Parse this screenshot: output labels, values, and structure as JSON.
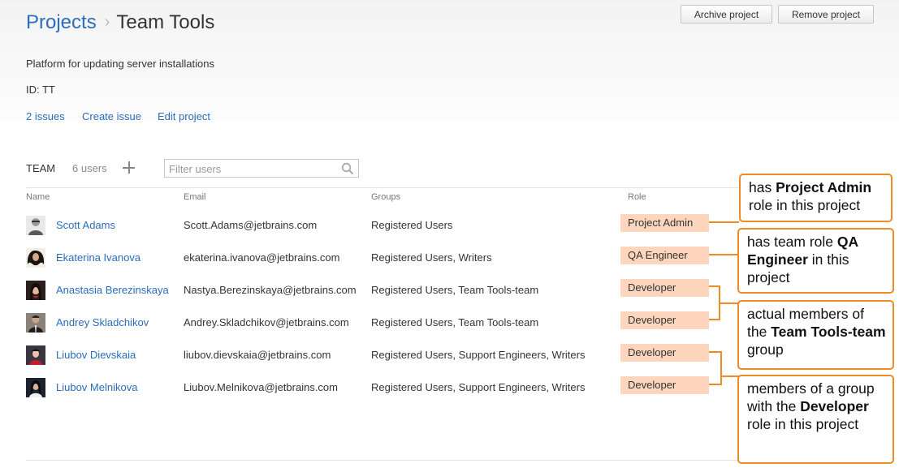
{
  "breadcrumb": {
    "root": "Projects",
    "separator": "›",
    "current": "Team Tools"
  },
  "header_buttons": {
    "archive": "Archive project",
    "remove": "Remove project"
  },
  "project": {
    "description": "Platform for updating server installations",
    "id": "ID: TT",
    "links": [
      "2 issues",
      "Create issue",
      "Edit project"
    ]
  },
  "team": {
    "label": "TEAM",
    "count": "6 users",
    "filter_placeholder": "Filter users"
  },
  "columns": {
    "name": "Name",
    "email": "Email",
    "groups": "Groups",
    "role": "Role"
  },
  "members": [
    {
      "name": "Scott Adams",
      "email": "Scott.Adams@jetbrains.com",
      "groups": "Registered Users",
      "role": "Project Admin",
      "avatar": "gray-portrait"
    },
    {
      "name": "Ekaterina Ivanova",
      "email": "ekaterina.ivanova@jetbrains.com",
      "groups": "Registered Users, Writers",
      "role": "QA Engineer",
      "avatar": "dark-hair-portrait"
    },
    {
      "name": "Anastasia Berezinskaya",
      "email": "Nastya.Berezinskaya@jetbrains.com",
      "groups": "Registered Users, Team Tools-team",
      "role": "Developer",
      "avatar": "dark-hair-portrait"
    },
    {
      "name": "Andrey Skladchikov",
      "email": "Andrey.Skladchikov@jetbrains.com",
      "groups": "Registered Users, Team Tools-team",
      "role": "Developer",
      "avatar": "suit-portrait"
    },
    {
      "name": "Liubov Dievskaia",
      "email": "liubov.dievskaia@jetbrains.com",
      "groups": "Registered Users, Support Engineers, Writers",
      "role": "Developer",
      "avatar": "red-portrait"
    },
    {
      "name": "Liubov Melnikova",
      "email": "Liubov.Melnikova@jetbrains.com",
      "groups": "Registered Users, Support Engineers, Writers",
      "role": "Developer",
      "avatar": "dark-portrait"
    }
  ],
  "callouts": {
    "project_admin": {
      "t1": "has ",
      "b1": "Project Admin",
      "t2": " role in this project"
    },
    "qa_engineer": {
      "t1": "has team role ",
      "b1": "QA Engineer",
      "t2": " in this project"
    },
    "team_group": {
      "t1": "actual members of the ",
      "b1": "Team Tools-team",
      "t2": " group"
    },
    "developer_group": {
      "t1": "members of  a group with the ",
      "b1": "Developer",
      "t2": " role in this project"
    }
  },
  "colors": {
    "link": "#2a6db9",
    "role_badge": "#fdd6bd",
    "callout_border": "#ef8b25"
  }
}
